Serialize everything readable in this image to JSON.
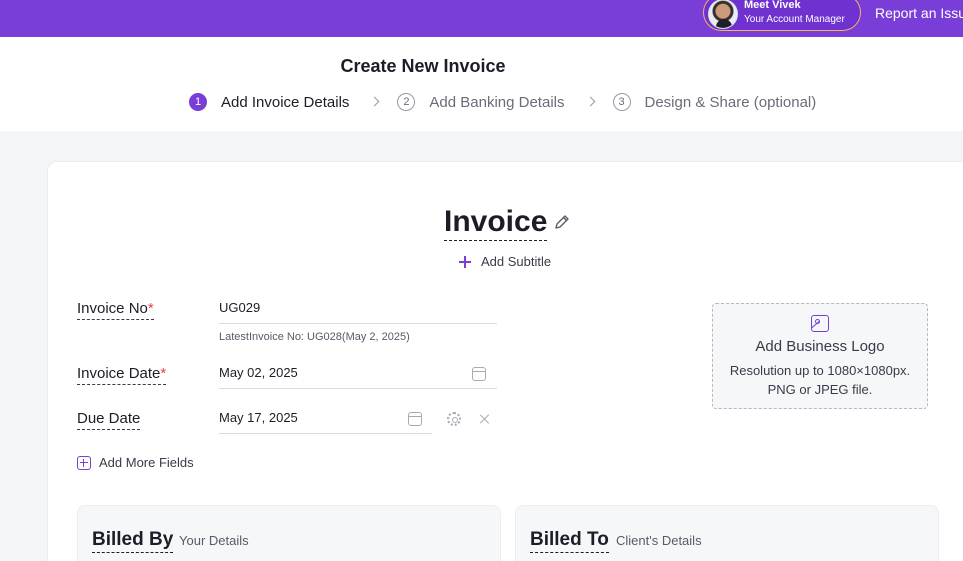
{
  "topbar": {
    "manager_name": "Meet Vivek",
    "manager_role": "Your Account Manager",
    "report_label": "Report an Issue"
  },
  "header": {
    "title": "Create New Invoice",
    "steps": [
      {
        "number": "1",
        "label": "Add Invoice Details",
        "active": true
      },
      {
        "number": "2",
        "label": "Add Banking Details",
        "active": false
      },
      {
        "number": "3",
        "label": "Design & Share (optional)",
        "active": false
      }
    ]
  },
  "invoice": {
    "title": "Invoice",
    "add_subtitle": "Add Subtitle",
    "fields": {
      "invoice_no_label": "Invoice No",
      "invoice_no_value": "UG029",
      "invoice_no_hint": "LatestInvoice No: UG028(May 2, 2025)",
      "invoice_date_label": "Invoice Date",
      "invoice_date_value": "May 02, 2025",
      "due_date_label": "Due Date",
      "due_date_value": "May 17, 2025",
      "required_mark": "*"
    },
    "add_more_fields": "Add More Fields"
  },
  "logo": {
    "title": "Add Business Logo",
    "description_line1": "Resolution up to 1080×1080px.",
    "description_line2": "PNG or JPEG file."
  },
  "billed_by": {
    "title": "Billed By",
    "subtitle": "Your Details"
  },
  "billed_to": {
    "title": "Billed To",
    "subtitle": "Client's Details"
  },
  "colors": {
    "accent": "#7a3ed8",
    "required": "#e0434f",
    "manager_border": "#f3b45d"
  }
}
